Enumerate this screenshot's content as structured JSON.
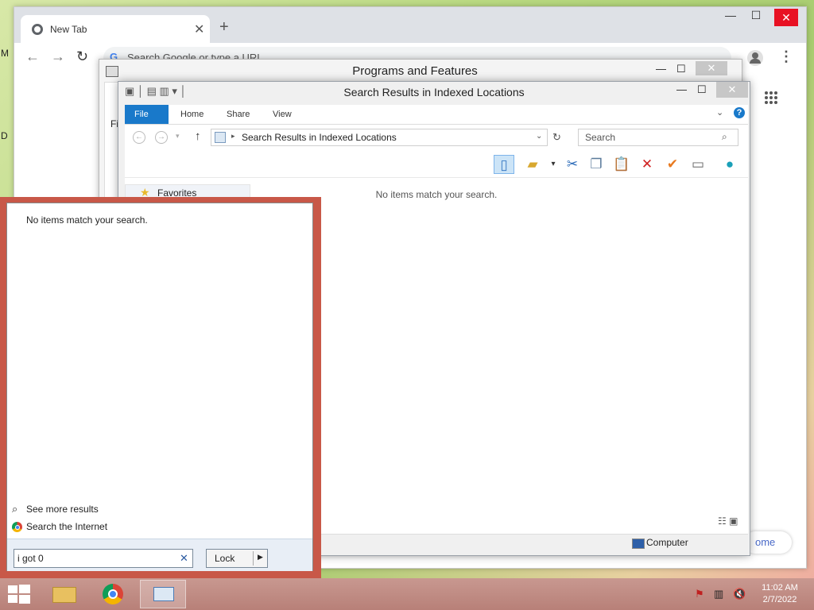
{
  "desktop": {
    "edge_letters": [
      "M",
      "D"
    ]
  },
  "chrome": {
    "tab_title": "New Tab",
    "tab_close": "✕",
    "new_tab": "+",
    "minimize": "—",
    "maximize": "☐",
    "close": "✕",
    "back": "←",
    "forward": "→",
    "reload": "↻",
    "omnibox_placeholder": "Search Google or type a URL",
    "chip_text": "ome"
  },
  "programs_window": {
    "title": "Programs and Features",
    "minimize": "—",
    "maximize": "☐",
    "close": "✕",
    "partial_label": "Fi"
  },
  "search_window": {
    "title": "Search Results in Indexed Locations",
    "minimize": "—",
    "maximize": "☐",
    "close": "✕",
    "ribbon_tabs": [
      "File",
      "Home",
      "Share",
      "View"
    ],
    "address_path": "Search Results in Indexed Locations",
    "search_placeholder": "Search",
    "no_items": "No items match your search.",
    "nav_favorites": "Favorites",
    "status_computer": "Computer"
  },
  "start_search": {
    "no_items": "No items match your search.",
    "see_more": "See more results",
    "search_internet": "Search the Internet",
    "query_value": "i got 0",
    "power_button": "Lock"
  },
  "taskbar": {
    "time": "11:02 AM",
    "date": "2/7/2022"
  }
}
